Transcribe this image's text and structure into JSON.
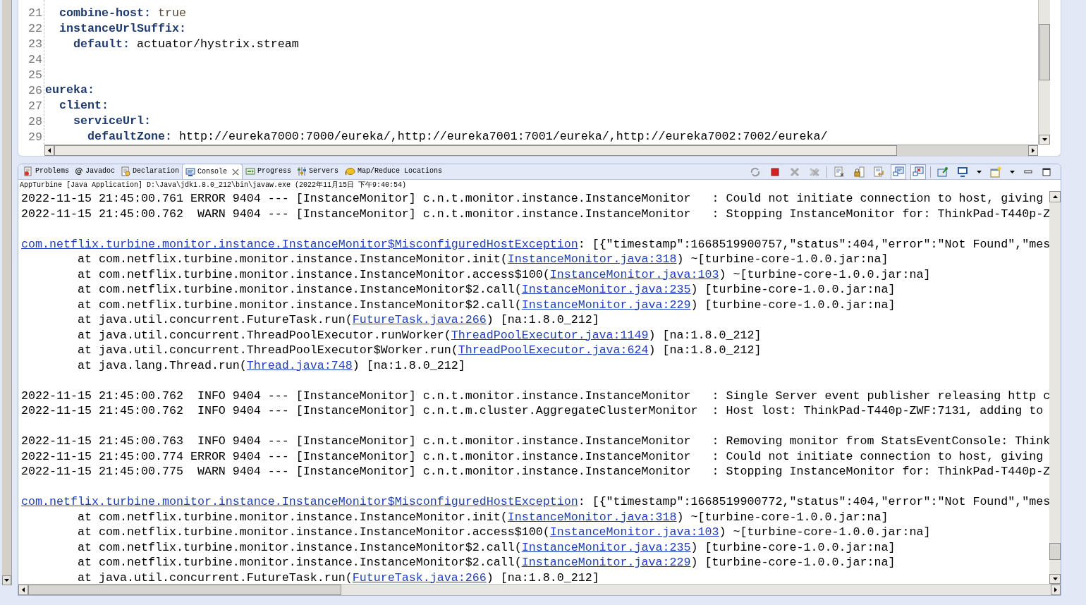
{
  "editor": {
    "lines": [
      {
        "number": "21",
        "key": "  combine-host:",
        "value": "true",
        "literal": true
      },
      {
        "number": "22",
        "key": "  instanceUrlSuffix:"
      },
      {
        "number": "23",
        "key": "    default:",
        "value": "actuator/hystrix.stream",
        "literal": false
      },
      {
        "number": "24"
      },
      {
        "number": "25"
      },
      {
        "number": "26",
        "key": "eureka:"
      },
      {
        "number": "27",
        "key": "  client:"
      },
      {
        "number": "28",
        "key": "    serviceUrl:"
      },
      {
        "number": "29",
        "key": "      defaultZone:",
        "value": "http://eureka7000:7000/eureka/,http://eureka7001:7001/eureka/,http://eureka7002:7002/eureka/",
        "literal": false
      }
    ]
  },
  "views": {
    "tabs": [
      {
        "label": "Problems",
        "selected": false,
        "closable": false
      },
      {
        "label": "Javadoc",
        "selected": false,
        "closable": false
      },
      {
        "label": "Declaration",
        "selected": false,
        "closable": false
      },
      {
        "label": "Console",
        "selected": true,
        "closable": true
      },
      {
        "label": "Progress",
        "selected": false,
        "closable": false
      },
      {
        "label": "Servers",
        "selected": false,
        "closable": false
      },
      {
        "label": "Map/Reduce Locations",
        "selected": false,
        "closable": false
      }
    ],
    "toolbar": {
      "show_stdout_pressed": true,
      "show_stderr_pressed": true
    }
  },
  "console": {
    "description": "AppTurbine [Java Application] D:\\Java\\jdk1.8.0_212\\bin\\javaw.exe (2022年11月15日 下午9:40:54)",
    "lines": [
      {
        "kind": "text",
        "parts": [
          {
            "text": "2022-11-15 21:45:00.761 ERROR 9404 --- [InstanceMonitor] c.n.t.monitor.instance.InstanceMonitor   : Could not initiate connection to host, giving",
            "link": false
          }
        ]
      },
      {
        "kind": "text",
        "parts": [
          {
            "text": "2022-11-15 21:45:00.762  WARN 9404 --- [InstanceMonitor] c.n.t.monitor.instance.InstanceMonitor   : Stopping InstanceMonitor for: ThinkPad-T440p-Z",
            "link": false
          }
        ]
      },
      {
        "kind": "blank"
      },
      {
        "kind": "text",
        "parts": [
          {
            "text": "com.netflix.turbine.monitor.instance.InstanceMonitor$MisconfiguredHostException",
            "link": true
          },
          {
            "text": ": [{\"timestamp\":1668519900757,\"status\":404,\"error\":\"Not Found\",\"mes",
            "link": false
          }
        ]
      },
      {
        "kind": "text",
        "parts": [
          {
            "text": "        at com.netflix.turbine.monitor.instance.InstanceMonitor.init(",
            "link": false
          },
          {
            "text": "InstanceMonitor.java:318",
            "link": true
          },
          {
            "text": ") ~[turbine-core-1.0.0.jar:na]",
            "link": false
          }
        ]
      },
      {
        "kind": "text",
        "parts": [
          {
            "text": "        at com.netflix.turbine.monitor.instance.InstanceMonitor.access$100(",
            "link": false
          },
          {
            "text": "InstanceMonitor.java:103",
            "link": true
          },
          {
            "text": ") ~[turbine-core-1.0.0.jar:na]",
            "link": false
          }
        ]
      },
      {
        "kind": "text",
        "parts": [
          {
            "text": "        at com.netflix.turbine.monitor.instance.InstanceMonitor$2.call(",
            "link": false
          },
          {
            "text": "InstanceMonitor.java:235",
            "link": true
          },
          {
            "text": ") [turbine-core-1.0.0.jar:na]",
            "link": false
          }
        ]
      },
      {
        "kind": "text",
        "parts": [
          {
            "text": "        at com.netflix.turbine.monitor.instance.InstanceMonitor$2.call(",
            "link": false
          },
          {
            "text": "InstanceMonitor.java:229",
            "link": true
          },
          {
            "text": ") [turbine-core-1.0.0.jar:na]",
            "link": false
          }
        ]
      },
      {
        "kind": "text",
        "parts": [
          {
            "text": "        at java.util.concurrent.FutureTask.run(",
            "link": false
          },
          {
            "text": "FutureTask.java:266",
            "link": true
          },
          {
            "text": ") [na:1.8.0_212]",
            "link": false
          }
        ]
      },
      {
        "kind": "text",
        "parts": [
          {
            "text": "        at java.util.concurrent.ThreadPoolExecutor.runWorker(",
            "link": false
          },
          {
            "text": "ThreadPoolExecutor.java:1149",
            "link": true
          },
          {
            "text": ") [na:1.8.0_212]",
            "link": false
          }
        ]
      },
      {
        "kind": "text",
        "parts": [
          {
            "text": "        at java.util.concurrent.ThreadPoolExecutor$Worker.run(",
            "link": false
          },
          {
            "text": "ThreadPoolExecutor.java:624",
            "link": true
          },
          {
            "text": ") [na:1.8.0_212]",
            "link": false
          }
        ]
      },
      {
        "kind": "text",
        "parts": [
          {
            "text": "        at java.lang.Thread.run(",
            "link": false
          },
          {
            "text": "Thread.java:748",
            "link": true
          },
          {
            "text": ") [na:1.8.0_212]",
            "link": false
          }
        ]
      },
      {
        "kind": "blank"
      },
      {
        "kind": "text",
        "parts": [
          {
            "text": "2022-11-15 21:45:00.762  INFO 9404 --- [InstanceMonitor] c.n.t.monitor.instance.InstanceMonitor   : Single Server event publisher releasing http c",
            "link": false
          }
        ]
      },
      {
        "kind": "text",
        "parts": [
          {
            "text": "2022-11-15 21:45:00.762  INFO 9404 --- [InstanceMonitor] c.n.t.m.cluster.AggregateClusterMonitor  : Host lost: ThinkPad-T440p-ZWF:7131, adding to",
            "link": false
          }
        ]
      },
      {
        "kind": "blank"
      },
      {
        "kind": "text",
        "parts": [
          {
            "text": "2022-11-15 21:45:00.763  INFO 9404 --- [InstanceMonitor] c.n.t.monitor.instance.InstanceMonitor   : Removing monitor from StatsEventConsole: Think",
            "link": false
          }
        ]
      },
      {
        "kind": "text",
        "parts": [
          {
            "text": "2022-11-15 21:45:00.774 ERROR 9404 --- [InstanceMonitor] c.n.t.monitor.instance.InstanceMonitor   : Could not initiate connection to host, giving",
            "link": false
          }
        ]
      },
      {
        "kind": "text",
        "parts": [
          {
            "text": "2022-11-15 21:45:00.775  WARN 9404 --- [InstanceMonitor] c.n.t.monitor.instance.InstanceMonitor   : Stopping InstanceMonitor for: ThinkPad-T440p-Z",
            "link": false
          }
        ]
      },
      {
        "kind": "blank"
      },
      {
        "kind": "text",
        "parts": [
          {
            "text": "com.netflix.turbine.monitor.instance.InstanceMonitor$MisconfiguredHostException",
            "link": true
          },
          {
            "text": ": [{\"timestamp\":1668519900772,\"status\":404,\"error\":\"Not Found\",\"mes",
            "link": false
          }
        ]
      },
      {
        "kind": "text",
        "parts": [
          {
            "text": "        at com.netflix.turbine.monitor.instance.InstanceMonitor.init(",
            "link": false
          },
          {
            "text": "InstanceMonitor.java:318",
            "link": true
          },
          {
            "text": ") ~[turbine-core-1.0.0.jar:na]",
            "link": false
          }
        ]
      },
      {
        "kind": "text",
        "parts": [
          {
            "text": "        at com.netflix.turbine.monitor.instance.InstanceMonitor.access$100(",
            "link": false
          },
          {
            "text": "InstanceMonitor.java:103",
            "link": true
          },
          {
            "text": ") ~[turbine-core-1.0.0.jar:na]",
            "link": false
          }
        ]
      },
      {
        "kind": "text",
        "parts": [
          {
            "text": "        at com.netflix.turbine.monitor.instance.InstanceMonitor$2.call(",
            "link": false
          },
          {
            "text": "InstanceMonitor.java:235",
            "link": true
          },
          {
            "text": ") [turbine-core-1.0.0.jar:na]",
            "link": false
          }
        ]
      },
      {
        "kind": "text",
        "parts": [
          {
            "text": "        at com.netflix.turbine.monitor.instance.InstanceMonitor$2.call(",
            "link": false
          },
          {
            "text": "InstanceMonitor.java:229",
            "link": true
          },
          {
            "text": ") [turbine-core-1.0.0.jar:na]",
            "link": false
          }
        ]
      },
      {
        "kind": "text",
        "parts": [
          {
            "text": "        at java.util.concurrent.FutureTask.run(",
            "link": false
          },
          {
            "text": "FutureTask.java:266",
            "link": true
          },
          {
            "text": ") [na:1.8.0_212]",
            "link": false
          }
        ]
      }
    ]
  }
}
